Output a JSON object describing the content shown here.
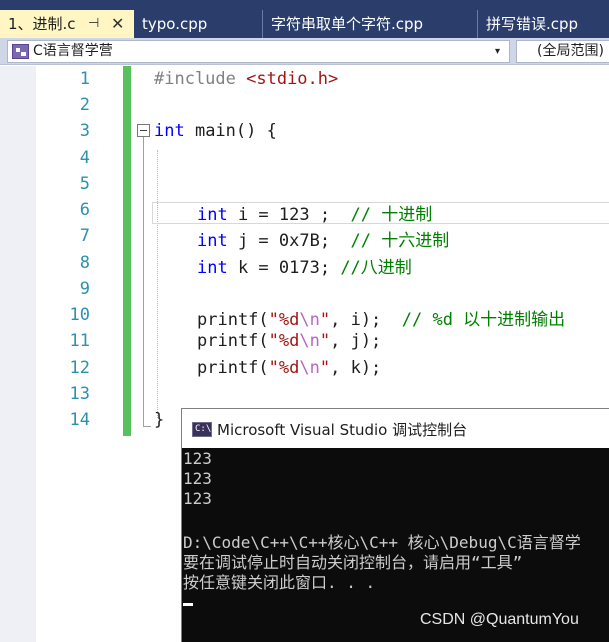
{
  "tabs": [
    {
      "label": "1、进制.c",
      "active": true,
      "pin": "⊣",
      "close": "✕"
    },
    {
      "label": "typo.cpp",
      "active": false
    },
    {
      "label": "字符串取单个字符.cpp",
      "active": false
    },
    {
      "label": "拼写错误.cpp",
      "active": false
    }
  ],
  "navbar": {
    "scope_icon": "class-scope-icon",
    "scope_label": "C语言督学营",
    "scope_arrow": "▾",
    "global_label": "(全局范围)"
  },
  "editor": {
    "line_numbers": [
      "1",
      "2",
      "3",
      "4",
      "5",
      "6",
      "7",
      "8",
      "9",
      "10",
      "11",
      "12",
      "13",
      "14"
    ],
    "lines": {
      "l1": {
        "pp": "#include ",
        "inc": "<stdio.h>"
      },
      "l3": {
        "kw": "int",
        "rest": " main() {"
      },
      "l6": {
        "kw": "int",
        "rest": " i = 123 ;  ",
        "cm": "// 十进制"
      },
      "l7": {
        "kw": "int",
        "rest": " j = 0x7B;  ",
        "cm": "// 十六进制"
      },
      "l8": {
        "kw": "int",
        "rest": " k = 0173; ",
        "cm": "//八进制"
      },
      "l10": {
        "fn": "printf(",
        "str1": "\"%d",
        "esc": "\\n",
        "str2": "\"",
        "rest": ", i);  ",
        "cm": "// %d 以十进制输出"
      },
      "l11": {
        "fn": "printf(",
        "str1": "\"%d",
        "esc": "\\n",
        "str2": "\"",
        "rest": ", j);"
      },
      "l12": {
        "fn": "printf(",
        "str1": "\"%d",
        "esc": "\\n",
        "str2": "\"",
        "rest": ", k);"
      },
      "l14": {
        "rest": "}"
      }
    }
  },
  "console": {
    "icon_text": "C:\\",
    "title": "Microsoft Visual Studio 调试控制台",
    "output": [
      "123",
      "123",
      "123",
      "",
      "D:\\Code\\C++\\C++核心\\C++ 核心\\Debug\\C语言督学",
      "要在调试停止时自动关闭控制台，请启用“工具”",
      "按任意键关闭此窗口. . ."
    ],
    "watermark": "CSDN @QuantumYou"
  },
  "colors": {
    "tabbar_bg": "#2b3d6b",
    "active_tab_bg": "#fff6c4",
    "keyword": "#0000ff",
    "comment": "#008000",
    "string": "#a31515",
    "line_number": "#2b91af",
    "change_bar": "#57c15d",
    "console_bg": "#0c0c0c"
  }
}
